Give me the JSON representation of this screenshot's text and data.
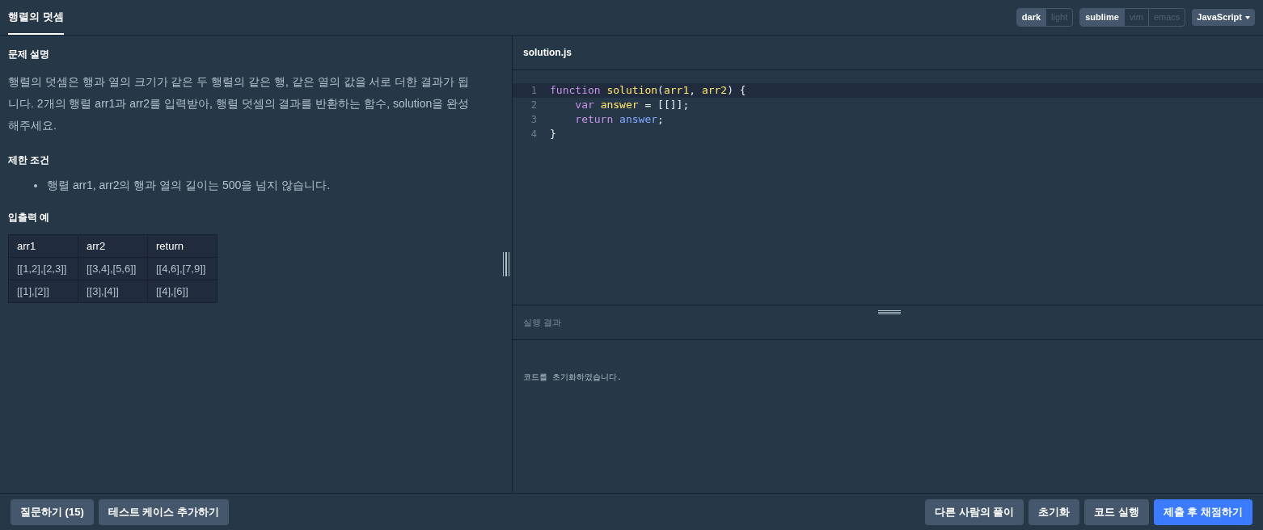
{
  "tab": {
    "label": "행렬의 덧셈",
    "selected": true
  },
  "toolbar": {
    "themes": [
      {
        "label": "dark",
        "selected": true
      },
      {
        "label": "light",
        "selected": false
      }
    ],
    "keymaps": [
      {
        "label": "sublime",
        "selected": true
      },
      {
        "label": "vim",
        "selected": false
      },
      {
        "label": "emacs",
        "selected": false
      }
    ],
    "language": "JavaScript"
  },
  "problem": {
    "sections": [
      {
        "heading": "문제 설명",
        "kind": "paragraph",
        "text": "행렬의 덧셈은 행과 열의 크기가 같은 두 행렬의 같은 행, 같은 열의 값을 서로 더한 결과가 됩니다. 2개의 행렬 arr1과 arr2를 입력받아, 행렬 덧셈의 결과를 반환하는 함수, solution을 완성해주세요."
      },
      {
        "heading": "제한 조건",
        "kind": "list",
        "items": [
          "행렬 arr1, arr2의 행과 열의 길이는 500을 넘지 않습니다."
        ]
      },
      {
        "heading": "입출력 예",
        "kind": "table",
        "columns": [
          "arr1",
          "arr2",
          "return"
        ],
        "rows": [
          [
            "[[1,2],[2,3]]",
            "[[3,4],[5,6]]",
            "[[4,6],[7,9]]"
          ],
          [
            "[[1],[2]]",
            "[[3],[4]]",
            "[[4],[6]]"
          ]
        ]
      }
    ]
  },
  "editor": {
    "filename": "solution.js",
    "lines": [
      {
        "number": "1",
        "selected": true,
        "tokens": [
          {
            "kind": "keyword",
            "text": "function "
          },
          {
            "kind": "name",
            "text": "solution"
          },
          {
            "kind": "plain",
            "text": "("
          },
          {
            "kind": "name",
            "text": "arr1"
          },
          {
            "kind": "plain",
            "text": ", "
          },
          {
            "kind": "name",
            "text": "arr2"
          },
          {
            "kind": "plain",
            "text": ") {"
          }
        ]
      },
      {
        "number": "2",
        "selected": false,
        "tokens": [
          {
            "kind": "keyword",
            "text": "    var "
          },
          {
            "kind": "name",
            "text": "answer"
          },
          {
            "kind": "plain",
            "text": " = [[]];"
          }
        ]
      },
      {
        "number": "3",
        "selected": false,
        "tokens": [
          {
            "kind": "keyword",
            "text": "    return "
          },
          {
            "kind": "variable",
            "text": "answer"
          },
          {
            "kind": "plain",
            "text": ";"
          }
        ]
      },
      {
        "number": "4",
        "selected": false,
        "tokens": [
          {
            "kind": "plain",
            "text": "}"
          }
        ]
      }
    ]
  },
  "result": {
    "title": "실행 결과",
    "output": "코드를 초기화하였습니다."
  },
  "footer": {
    "left": [
      {
        "label": "질문하기 (15)",
        "kind": "secondary"
      },
      {
        "label": "테스트 케이스 추가하기",
        "kind": "secondary"
      }
    ],
    "right": [
      {
        "label": "다른 사람의 풀이",
        "kind": "secondary"
      },
      {
        "label": "초기화",
        "kind": "secondary"
      },
      {
        "label": "코드 실행",
        "kind": "secondary"
      },
      {
        "label": "제출 후 채점하기",
        "kind": "primary"
      }
    ]
  }
}
